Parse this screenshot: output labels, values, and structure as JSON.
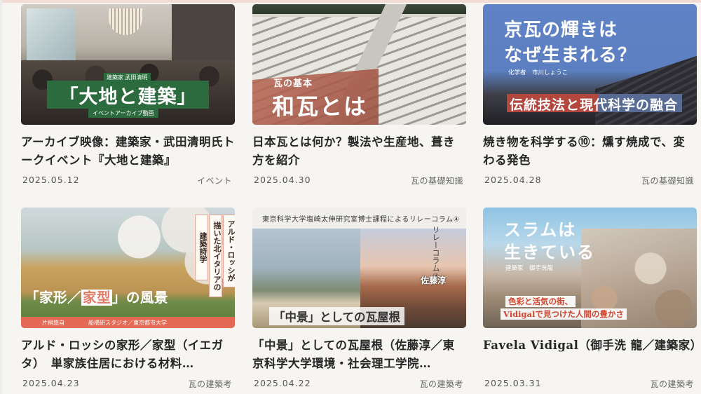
{
  "cards": [
    {
      "title": "アーカイブ映像：建築家・武田清明氏トークイベント『大地と建築』",
      "date": "2025.05.12",
      "category": "イベント",
      "thumb": {
        "tag_top": "建築家 武田清明",
        "headline": "「大地と建築」",
        "tag_bottom": "イベントアーカイブ動画"
      }
    },
    {
      "title": "日本瓦とは何か？製法や生産地、葺き方を紹介",
      "date": "2025.04.30",
      "category": "瓦の基礎知識",
      "thumb": {
        "subtitle": "瓦の基本",
        "headline": "和瓦とは"
      }
    },
    {
      "title": "焼き物を科学する⑩：燻す焼成で、変わる発色",
      "date": "2025.04.28",
      "category": "瓦の基礎知識",
      "thumb": {
        "line1": "京瓦の輝きは",
        "line2": "なぜ生まれる？",
        "credit": "化学者　市川しょうこ",
        "band": "伝統技法と現代科学の融合"
      }
    },
    {
      "title": "アルド・ロッシの家形／家型（イエガタ）　単家族住居における材料…",
      "date": "2025.04.23",
      "category": "瓦の建築考",
      "thumb": {
        "vlabels": [
          "建築詩学",
          "描いた北イタリアの",
          "アルド・ロッシが"
        ],
        "headline_a": "「家形",
        "headline_b": "家型",
        "headline_c": "」の風景",
        "band_left": "片桐悠自",
        "band_right": "船橋研スタジオ／東京都市大学"
      }
    },
    {
      "title": "「中景」としての瓦屋根（佐藤淳／東京科学大学環境・社会理工学院…",
      "date": "2025.04.22",
      "category": "瓦の建築考",
      "thumb": {
        "top_line": "東京科学大学塩崎太伸研究室博士課程によるリレーコラム④",
        "vertical": "リレーコラム④",
        "name": "佐藤淳",
        "headline": "「中景」としての瓦屋根"
      }
    },
    {
      "title": "Favela Vidigal（御手洗 龍／建築家）",
      "date": "2025.03.31",
      "category": "瓦の建築考",
      "thumb": {
        "line1": "スラムは",
        "line2": "生きている",
        "credit": "建築家　御手洗龍",
        "ribbon1": "色彩と活気の街、",
        "ribbon2": "Vidigalで見つけた人間の豊かさ"
      }
    }
  ]
}
